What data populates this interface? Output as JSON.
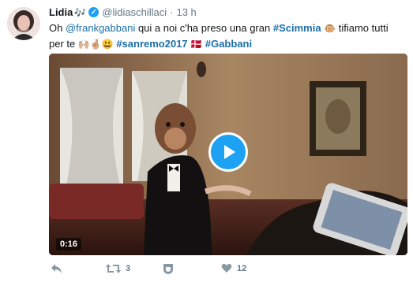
{
  "colors": {
    "accent": "#1da1f2",
    "link": "#1b6fa8",
    "icon": "#8899a6",
    "text": "#14171a",
    "meta": "#657786"
  },
  "tweet": {
    "display_name": "Lidia",
    "display_name_emoji": "🎶",
    "verified_icon": "verified-badge-icon",
    "handle": "@lidiaschillaci",
    "separator": "·",
    "time": "13 h",
    "text": {
      "part1": "Oh ",
      "mention": "@frankgabbani",
      "part2": " qui a noi c'ha preso una gran ",
      "tag1": "#Scimmia",
      "emoji1": "🐵",
      "part3": " tifiamo tutti per te ",
      "emoji2": "🙌🏼🤞🏼😃",
      "tag2": "#sanremo2017",
      "emoji3": "🇩🇰",
      "tag3": "#Gabbani"
    },
    "media": {
      "duration": "0:16",
      "play_icon": "play-icon"
    },
    "actions": {
      "reply_icon": "reply-icon",
      "retweet_icon": "retweet-icon",
      "retweet_count": "3",
      "shield_icon": "shield-icon",
      "like_icon": "heart-icon",
      "like_count": "12"
    }
  }
}
